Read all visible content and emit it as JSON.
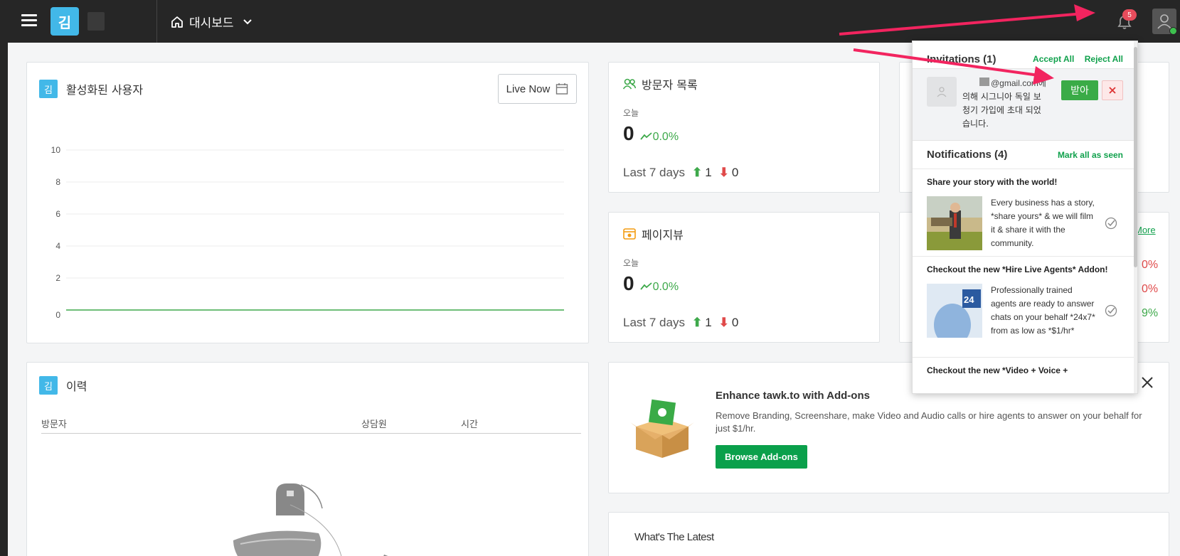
{
  "topbar": {
    "brand_initial": "김",
    "nav_label": "대시보드",
    "notification_count": "5"
  },
  "active_users": {
    "badge": "김",
    "title": "활성화된 사용자",
    "live_button": "Live Now",
    "chart_data": {
      "type": "line",
      "title": "",
      "xlabel": "",
      "ylabel": "",
      "ylim": [
        0,
        10
      ],
      "y_ticks": [
        "10",
        "8",
        "6",
        "4",
        "2",
        "0"
      ],
      "series": [
        {
          "values": [
            0,
            0,
            0,
            0,
            0,
            0,
            0,
            0,
            0,
            0,
            0,
            0
          ]
        }
      ],
      "grid": true,
      "line_color": "#3ea94b"
    }
  },
  "visitors": {
    "title": "방문자 목록",
    "today_label": "오늘",
    "value": "0",
    "pct": "0.0%",
    "last7_label": "Last 7 days",
    "up_count": "1",
    "down_count": "0"
  },
  "pageviews": {
    "title": "페이지뷰",
    "today_label": "오늘",
    "value": "0",
    "pct": "0.0%",
    "last7_label": "Last 7 days",
    "up_count": "1",
    "down_count": "0"
  },
  "partial_card": {
    "more_link": "More",
    "pct1": "0%",
    "pct2": "0%",
    "pct3": "9%"
  },
  "history": {
    "badge": "김",
    "title": "이력",
    "col_visitor": "방문자",
    "col_agent": "상담원",
    "col_time": "시간"
  },
  "addons": {
    "title": "Enhance tawk.to with Add-ons",
    "description": "Remove Branding, Screenshare, make Video and Audio calls or hire agents to answer on your behalf for just $1/hr.",
    "button": "Browse Add-ons"
  },
  "latest": {
    "title": "What's The Latest"
  },
  "panel": {
    "invitations_title": "Invitations (1)",
    "accept_all": "Accept All",
    "reject_all": "Reject All",
    "invite_email": "@gmail.com에",
    "invite_text": "의해 시그니아 독일 보청기 가입에 초대 되었습니다.",
    "accept_label": "받아",
    "notifications_title": "Notifications (4)",
    "mark_all": "Mark all as seen",
    "items": [
      {
        "title": "Share your story with the world!",
        "body": "Every business has a story, *share yours* & we will film it & share it with the community."
      },
      {
        "title": "Checkout the new *Hire Live Agents* Addon!",
        "body": "Professionally trained agents are ready to answer chats on your behalf *24x7* from as low as *$1/hr*",
        "image_text": "24"
      },
      {
        "title": "Checkout the new *Video + Voice +"
      }
    ]
  },
  "colors": {
    "topbar": "#262626",
    "brand_blue": "#42b8e8",
    "green": "#3ea94b",
    "red": "#e04a4a",
    "annotation": "#f2245f"
  }
}
